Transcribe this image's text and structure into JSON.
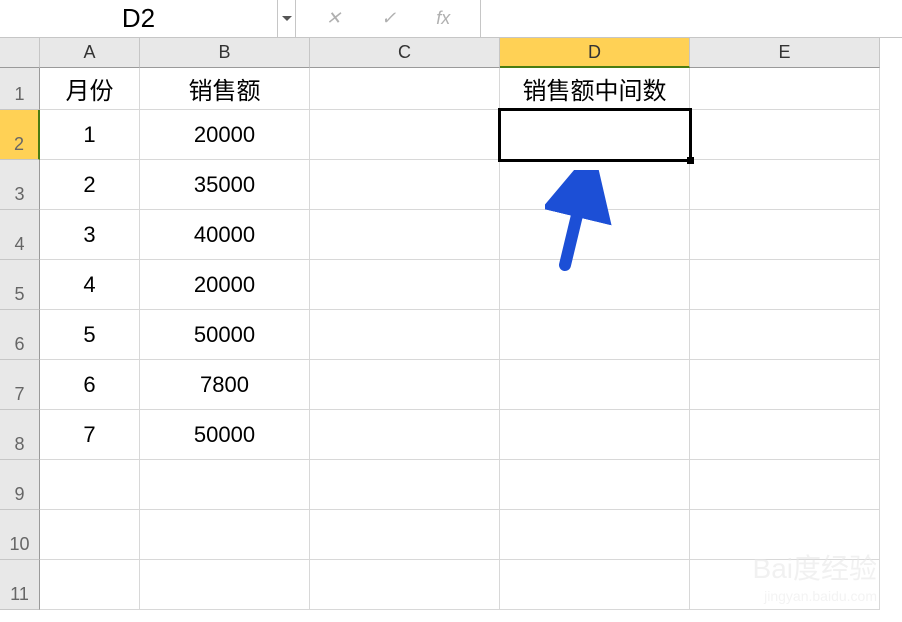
{
  "formula_bar": {
    "name_box": "D2",
    "formula": ""
  },
  "columns": [
    "A",
    "B",
    "C",
    "D",
    "E"
  ],
  "active_column": "D",
  "rows": [
    1,
    2,
    3,
    4,
    5,
    6,
    7,
    8,
    9,
    10,
    11
  ],
  "active_row": 2,
  "selected_cell": "D2",
  "headers": {
    "A": "月份",
    "B": "销售额",
    "D": "销售额中间数"
  },
  "data": [
    {
      "month": "1",
      "sales": "20000"
    },
    {
      "month": "2",
      "sales": "35000"
    },
    {
      "month": "3",
      "sales": "40000"
    },
    {
      "month": "4",
      "sales": "20000"
    },
    {
      "month": "5",
      "sales": "50000"
    },
    {
      "month": "6",
      "sales": "7800"
    },
    {
      "month": "7",
      "sales": "50000"
    }
  ],
  "watermark": {
    "brand": "Bai度经验",
    "url": "jingyan.baidu.com"
  }
}
